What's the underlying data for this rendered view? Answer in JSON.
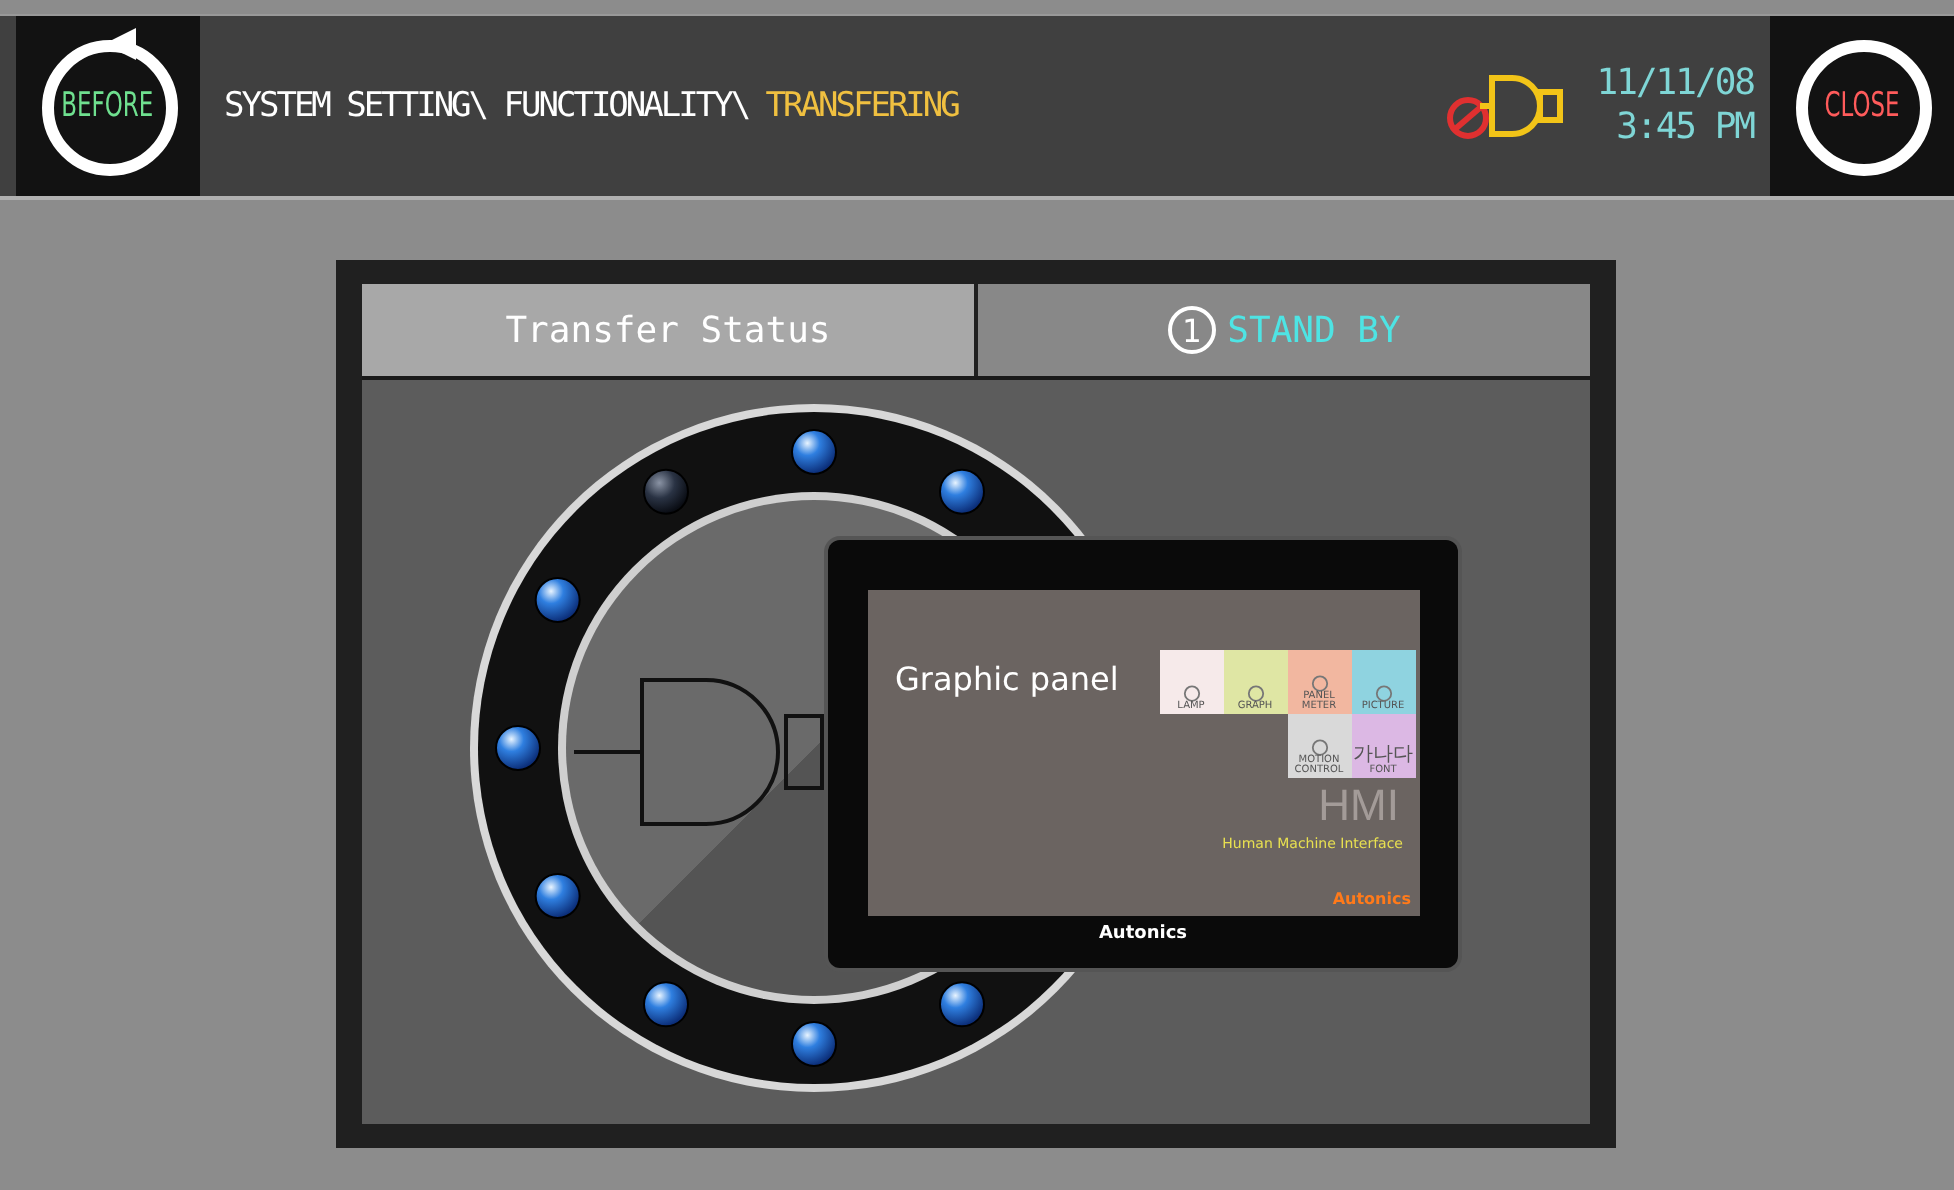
{
  "header": {
    "back_button": "BEFORE",
    "breadcrumb": [
      {
        "label": "SYSTEM SETTING\\ ",
        "selected": false
      },
      {
        "label": "FUNCTIONALITY\\ ",
        "selected": false
      },
      {
        "label": "TRANSFERING",
        "selected": true
      }
    ],
    "buzzer_muted": true,
    "date": "11/11/08",
    "time": "3:45 PM",
    "close_button": "CLOSE"
  },
  "status": {
    "label": "Transfer Status",
    "step": "1",
    "value": "STAND BY"
  },
  "lights": [
    {
      "on": true
    },
    {
      "on": true
    },
    {
      "on": true
    },
    {
      "on": true
    },
    {
      "on": true
    },
    {
      "on": true
    },
    {
      "on": true
    },
    {
      "on": true
    },
    {
      "on": false
    }
  ],
  "device": {
    "title": "Graphic panel",
    "tiles": [
      {
        "label": "LAMP",
        "color": "#f6eaea"
      },
      {
        "label": "GRAPH",
        "color": "#dfe6a4"
      },
      {
        "label": "PANEL METER",
        "color": "#f2b7a0"
      },
      {
        "label": "PICTURE",
        "color": "#8fd3e0"
      },
      {
        "label": "MOTION CONTROL",
        "color": "#d9d9d9"
      },
      {
        "label": "FONT",
        "color": "#dcb8e4",
        "glyph": "가나다"
      }
    ],
    "tagline": "Human Machine Interface",
    "watermark": "HMI",
    "screen_brand": "Autonics",
    "bezel_brand": "Autonics"
  }
}
